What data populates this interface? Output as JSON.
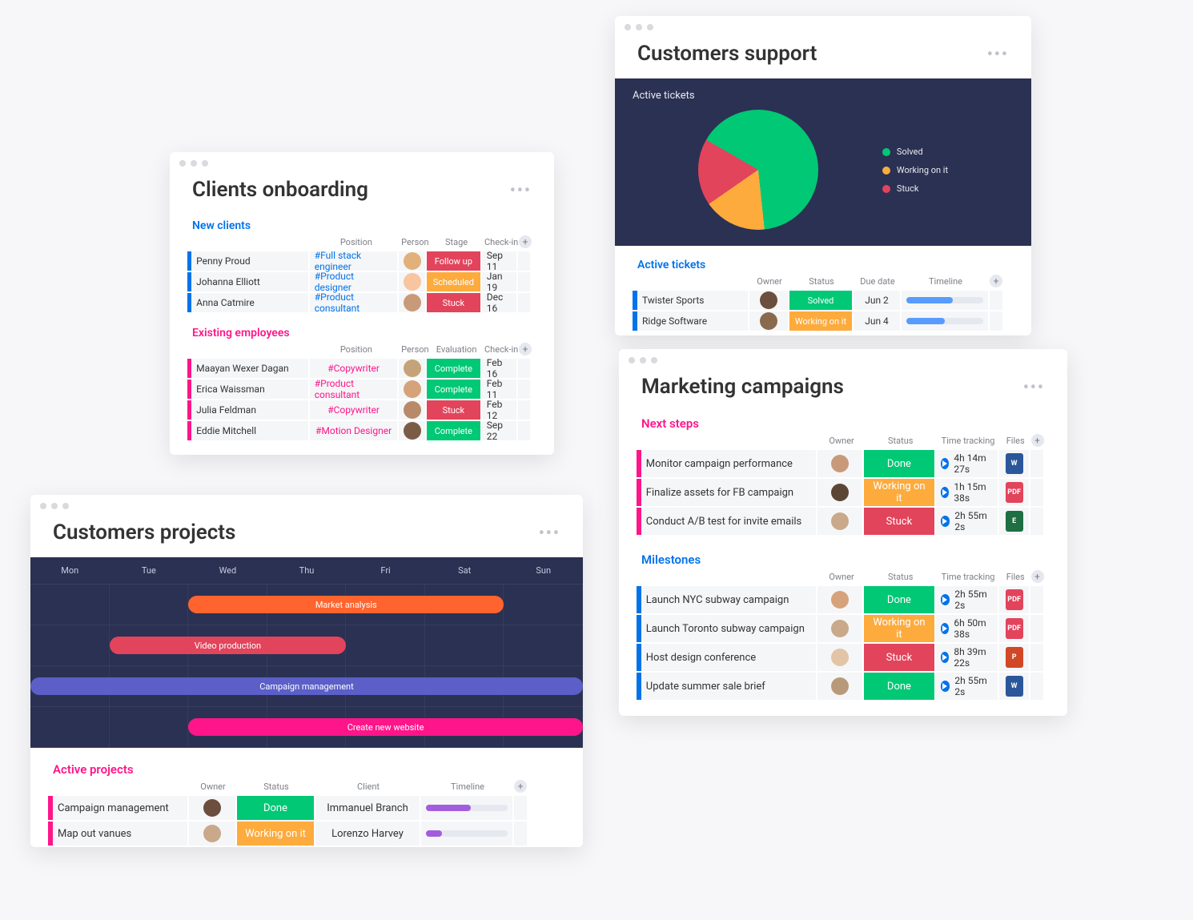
{
  "clients_onboarding": {
    "title": "Clients onboarding",
    "new_clients": {
      "label": "New clients",
      "columns": {
        "position": "Position",
        "person": "Person",
        "stage": "Stage",
        "checkin": "Check-in"
      },
      "rows": [
        {
          "name": "Penny Proud",
          "position": "#Full stack engineer",
          "avatar": "#e2b07a",
          "stage": {
            "label": "Follow up",
            "color": "#e2445c"
          },
          "checkin": "Sep 11"
        },
        {
          "name": "Johanna Elliott",
          "position": "#Product designer",
          "avatar": "#f7c59f",
          "stage": {
            "label": "Scheduled",
            "color": "#fdab3d"
          },
          "checkin": "Jan 19"
        },
        {
          "name": "Anna Catmire",
          "position": "#Product consultant",
          "avatar": "#c99a7a",
          "stage": {
            "label": "Stuck",
            "color": "#e2445c"
          },
          "checkin": "Dec 16"
        }
      ]
    },
    "existing_employees": {
      "label": "Existing employees",
      "columns": {
        "position": "Position",
        "person": "Person",
        "evaluation": "Evaluation",
        "checkin": "Check-in"
      },
      "rows": [
        {
          "name": "Maayan Wexer Dagan",
          "position": "#Copywriter",
          "avatar": "#c5a37a",
          "eval": {
            "label": "Complete",
            "color": "#00c875"
          },
          "checkin": "Feb 16"
        },
        {
          "name": "Erica Waissman",
          "position": "#Product consultant",
          "avatar": "#d6a27a",
          "eval": {
            "label": "Complete",
            "color": "#00c875"
          },
          "checkin": "Feb 11"
        },
        {
          "name": "Julia Feldman",
          "position": "#Copywriter",
          "avatar": "#b88a6a",
          "eval": {
            "label": "Stuck",
            "color": "#e2445c"
          },
          "checkin": "Feb 12"
        },
        {
          "name": "Eddie Mitchell",
          "position": "#Motion Designer",
          "avatar": "#7a5c46",
          "eval": {
            "label": "Complete",
            "color": "#00c875"
          },
          "checkin": "Sep 22"
        }
      ]
    }
  },
  "customers_support": {
    "title": "Customers support",
    "dark_title": "Active tickets",
    "legend": [
      {
        "label": "Solved",
        "color": "#00c875"
      },
      {
        "label": "Working on it",
        "color": "#fdab3d"
      },
      {
        "label": "Stuck",
        "color": "#e2445c"
      }
    ],
    "table": {
      "label": "Active tickets",
      "columns": {
        "owner": "Owner",
        "status": "Status",
        "due": "Due date",
        "timeline": "Timeline"
      },
      "rows": [
        {
          "name": "Twister Sports",
          "avatar": "#6b4e3d",
          "status": {
            "label": "Solved",
            "color": "#00c875"
          },
          "due": "Jun 2",
          "tl": {
            "color": "#579bfc",
            "pct": 60
          }
        },
        {
          "name": "Ridge Software",
          "avatar": "#8a6a4e",
          "status": {
            "label": "Working on it",
            "color": "#fdab3d"
          },
          "due": "Jun 4",
          "tl": {
            "color": "#579bfc",
            "pct": 50
          }
        }
      ]
    }
  },
  "chart_data": {
    "type": "pie",
    "title": "Active tickets",
    "series": [
      {
        "name": "Solved",
        "value": 65,
        "color": "#00c875"
      },
      {
        "name": "Working on it",
        "value": 17,
        "color": "#fdab3d"
      },
      {
        "name": "Stuck",
        "value": 18,
        "color": "#e2445c"
      }
    ]
  },
  "customers_projects": {
    "title": "Customers projects",
    "days": [
      "Mon",
      "Tue",
      "Wed",
      "Thu",
      "Fri",
      "Sat",
      "Sun"
    ],
    "bars": [
      {
        "label": "Market analysis",
        "color": "#ff642e",
        "start": 2,
        "span": 4
      },
      {
        "label": "Video production",
        "color": "#e2445c",
        "start": 1,
        "span": 3
      },
      {
        "label": "Campaign management",
        "color": "#5b5fc7",
        "start": 0,
        "span": 7
      },
      {
        "label": "Create new website",
        "color": "#ff158a",
        "start": 2,
        "span": 5
      }
    ],
    "active": {
      "label": "Active projects",
      "columns": {
        "owner": "Owner",
        "status": "Status",
        "client": "Client",
        "timeline": "Timeline"
      },
      "rows": [
        {
          "name": "Campaign management",
          "avatar": "#6b4e3d",
          "status": {
            "label": "Done",
            "color": "#00c875"
          },
          "client": "Immanuel Branch",
          "tl": {
            "color": "#a25ddc",
            "pct": 55
          }
        },
        {
          "name": "Map out vanues",
          "avatar": "#caa88a",
          "status": {
            "label": "Working on it",
            "color": "#fdab3d"
          },
          "client": "Lorenzo Harvey",
          "tl": {
            "color": "#a25ddc",
            "pct": 20
          }
        }
      ]
    }
  },
  "marketing": {
    "title": "Marketing campaigns",
    "next_steps": {
      "label": "Next steps",
      "columns": {
        "owner": "Owner",
        "status": "Status",
        "track": "Time tracking",
        "files": "Files"
      },
      "rows": [
        {
          "name": "Monitor campaign performance",
          "avatar": "#c99a7a",
          "status": {
            "label": "Done",
            "color": "#00c875"
          },
          "track": "4h 14m 27s",
          "file": {
            "glyph": "W",
            "color": "#2b579a"
          }
        },
        {
          "name": "Finalize assets for FB campaign",
          "avatar": "#5b4636",
          "status": {
            "label": "Working on it",
            "color": "#fdab3d"
          },
          "track": "1h 15m 38s",
          "file": {
            "glyph": "PDF",
            "color": "#e2445c"
          }
        },
        {
          "name": "Conduct A/B test for invite emails",
          "avatar": "#caa88a",
          "status": {
            "label": "Stuck",
            "color": "#e2445c"
          },
          "track": "2h 55m 2s",
          "file": {
            "glyph": "E",
            "color": "#1e6f42"
          }
        }
      ]
    },
    "milestones": {
      "label": "Milestones",
      "columns": {
        "owner": "Owner",
        "status": "Status",
        "track": "Time tracking",
        "files": "Files"
      },
      "rows": [
        {
          "name": "Launch NYC subway campaign",
          "avatar": "#d6a27a",
          "status": {
            "label": "Done",
            "color": "#00c875"
          },
          "track": "2h 55m 2s",
          "file": {
            "glyph": "PDF",
            "color": "#e2445c"
          }
        },
        {
          "name": "Launch Toronto subway campaign",
          "avatar": "#caa88a",
          "status": {
            "label": "Working on it",
            "color": "#fdab3d"
          },
          "track": "6h 50m 38s",
          "file": {
            "glyph": "PDF",
            "color": "#e2445c"
          }
        },
        {
          "name": "Host design conference",
          "avatar": "#e2c5a6",
          "status": {
            "label": "Stuck",
            "color": "#e2445c"
          },
          "track": "8h 39m 22s",
          "file": {
            "glyph": "P",
            "color": "#d24726"
          }
        },
        {
          "name": "Update summer sale brief",
          "avatar": "#b89a7a",
          "status": {
            "label": "Done",
            "color": "#00c875"
          },
          "track": "2h 55m 2s",
          "file": {
            "glyph": "W",
            "color": "#2b579a"
          }
        }
      ]
    }
  }
}
